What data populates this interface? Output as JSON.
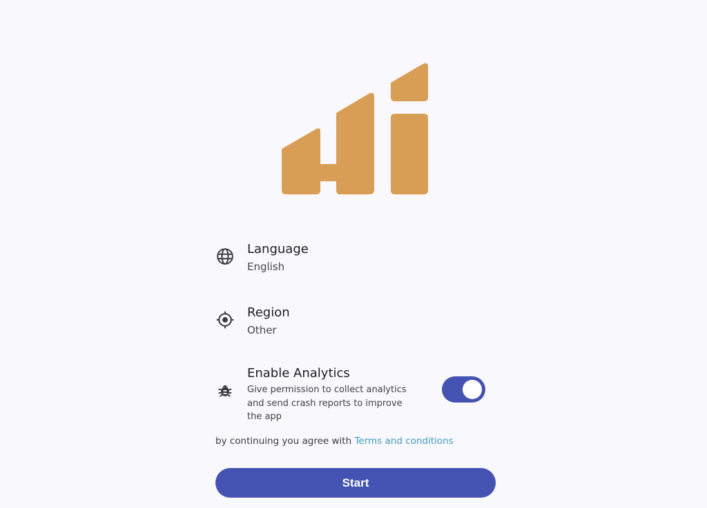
{
  "brand": {
    "logo_color": "#d99e55"
  },
  "settings": {
    "language": {
      "icon": "globe-icon",
      "title": "Language",
      "value": "English"
    },
    "region": {
      "icon": "location-target-icon",
      "title": "Region",
      "value": "Other"
    },
    "analytics": {
      "icon": "bug-icon",
      "title": "Enable Analytics",
      "description": "Give permission to collect analytics and send crash reports to improve the app",
      "enabled": true
    }
  },
  "terms": {
    "prefix": "by continuing you agree with ",
    "link_label": "Terms and conditions"
  },
  "start_button": {
    "label": "Start"
  },
  "colors": {
    "accent": "#4453b2",
    "link": "#3f9bc2",
    "background": "#f9f8fc"
  }
}
